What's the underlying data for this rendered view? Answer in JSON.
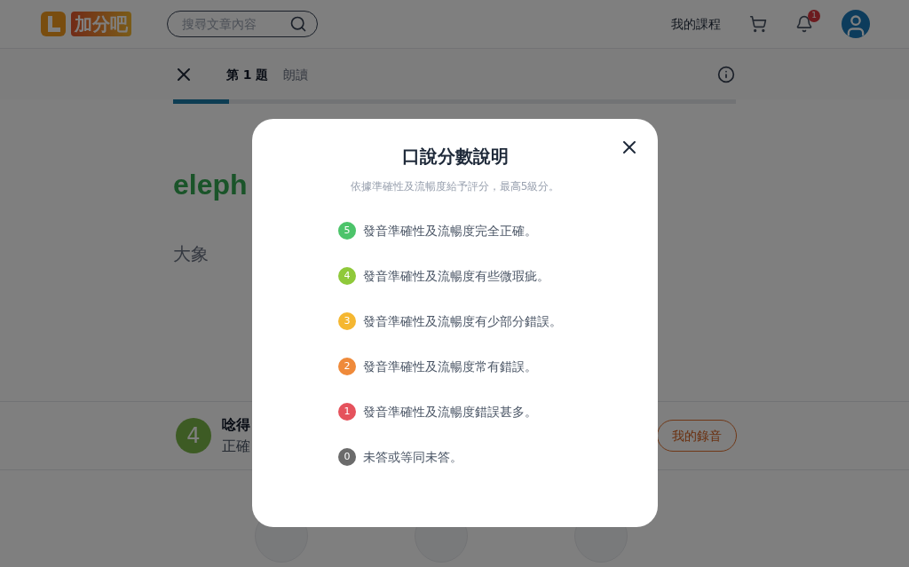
{
  "header": {
    "logo_text": "加分吧",
    "search": {
      "placeholder": "搜尋文章內容"
    },
    "nav_link": "我的課程",
    "notification_count": "1"
  },
  "question_bar": {
    "tabs": [
      {
        "label": "第 1 題",
        "selected": true
      },
      {
        "label": "朗讀",
        "selected": false
      }
    ],
    "progress": {
      "level": 0.1
    }
  },
  "word": "eleph",
  "meaning": "大象",
  "result": {
    "score": "4",
    "title": "唸得",
    "subtitle": "正確",
    "recording_button": "我的錄音"
  },
  "modal": {
    "title": "口說分數說明",
    "subtitle": "依據準確性及流暢度給予評分，最高5級分。",
    "levels": [
      {
        "score": "5",
        "color": "#4cc46a",
        "text": "發音準確性及流暢度完全正確。"
      },
      {
        "score": "4",
        "color": "#8fc93a",
        "text": "發音準確性及流暢度有些微瑕疵。"
      },
      {
        "score": "3",
        "color": "#f5b731",
        "text": "發音準確性及流暢度有少部分錯誤。"
      },
      {
        "score": "2",
        "color": "#ef8a3a",
        "text": "發音準確性及流暢度常有錯誤。"
      },
      {
        "score": "1",
        "color": "#e5525c",
        "text": "發音準確性及流暢度錯誤甚多。"
      },
      {
        "score": "0",
        "color": "#6b6b6b",
        "text": "未答或等同未答。"
      }
    ]
  }
}
